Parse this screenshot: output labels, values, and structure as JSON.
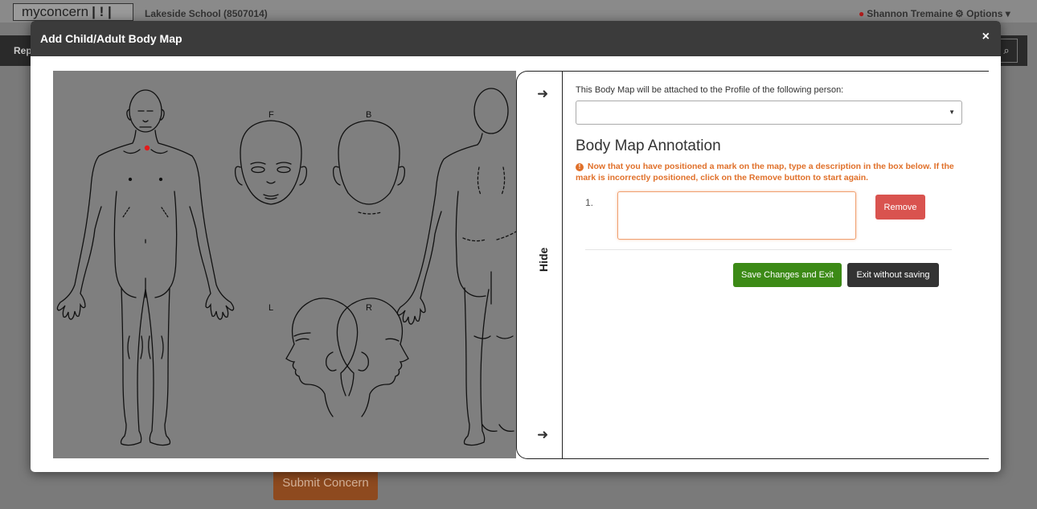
{
  "app": {
    "logo_text": "myconcern",
    "logo_bars": "| ! |",
    "school": "Lakeside School (8507014)",
    "user_name": "Shannon Tremaine",
    "options_label": "Options",
    "nav_label": "Rep",
    "submit_label": "Submit Concern"
  },
  "modal": {
    "title": "Add Child/Adult Body Map",
    "close_icon": "×"
  },
  "body_map": {
    "head_labels": {
      "front": "F",
      "back": "B",
      "left": "L",
      "right": "R"
    },
    "marker_color": "#e31b1b"
  },
  "side_panel": {
    "hide_label": "Hide",
    "arrow_top": "➜",
    "arrow_bottom": "➜"
  },
  "form": {
    "attach_text": "This Body Map will be attached to the Profile of the following person:",
    "person_select_value": "",
    "annotation_title": "Body Map Annotation",
    "notice": "Now that you have positioned a mark on the map, type a description in the box below. If the mark is incorrectly positioned, click on the Remove button to start again.",
    "annotations": [
      {
        "number": "1.",
        "text": ""
      }
    ],
    "remove_label": "Remove",
    "save_label": "Save Changes and Exit",
    "exit_label": "Exit without saving"
  },
  "colors": {
    "header_bg": "#3b3b3b",
    "remove_btn": "#d9534f",
    "save_btn": "#3c8a16",
    "exit_btn": "#333333",
    "notice": "#e0702a",
    "map_bg": "#7f7f7f"
  }
}
